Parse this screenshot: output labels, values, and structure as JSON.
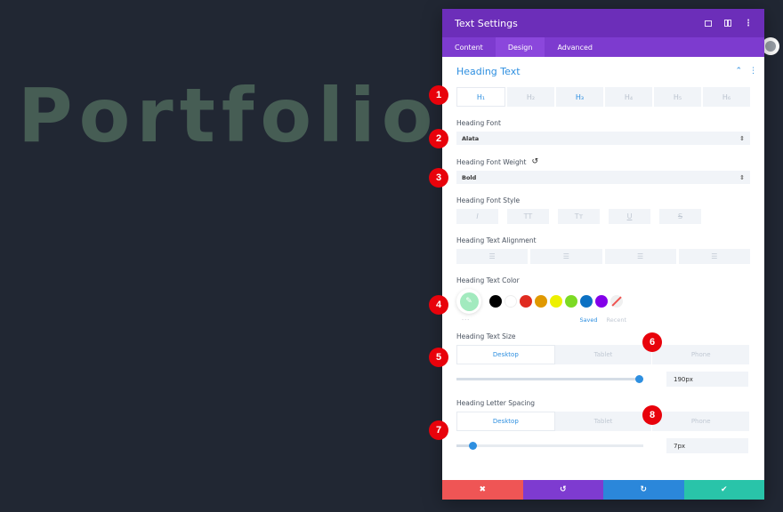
{
  "canvas": {
    "heading_text": "Portfolio"
  },
  "modal": {
    "title": "Text Settings",
    "header_icons": [
      "expand-icon",
      "split-view-icon",
      "more-options-icon"
    ],
    "tabs": [
      {
        "label": "Content",
        "active": false
      },
      {
        "label": "Design",
        "active": true
      },
      {
        "label": "Advanced",
        "active": false
      }
    ],
    "section": {
      "title": "Heading Text",
      "heading_levels": [
        {
          "label": "H₁",
          "state": "active"
        },
        {
          "label": "H₂",
          "state": "default"
        },
        {
          "label": "H₃",
          "state": "set"
        },
        {
          "label": "H₄",
          "state": "default"
        },
        {
          "label": "H₅",
          "state": "default"
        },
        {
          "label": "H₆",
          "state": "default"
        }
      ],
      "heading_font": {
        "label": "Heading Font",
        "value": "Alata"
      },
      "heading_font_weight": {
        "label": "Heading Font Weight",
        "value": "Bold"
      },
      "heading_font_style": {
        "label": "Heading Font Style",
        "buttons": [
          {
            "name": "italic",
            "glyph": "I"
          },
          {
            "name": "uppercase",
            "glyph": "TT"
          },
          {
            "name": "capitalize",
            "glyph": "Tт"
          },
          {
            "name": "underline",
            "glyph": "U"
          },
          {
            "name": "strikethrough",
            "glyph": "S"
          }
        ]
      },
      "heading_text_alignment": {
        "label": "Heading Text Alignment",
        "buttons": [
          "align-left",
          "align-center",
          "align-right",
          "justify"
        ]
      },
      "heading_text_color": {
        "label": "Heading Text Color",
        "selected": "#a2eabe",
        "swatches": [
          "#000000",
          "#ffffff",
          "#e02b20",
          "#e09900",
          "#edf000",
          "#7cda24",
          "#0c71c3",
          "#8300e9"
        ],
        "more_label": "···",
        "saved_label": "Saved",
        "recent_label": "Recent"
      },
      "heading_text_size": {
        "label": "Heading Text Size",
        "devices": [
          "Desktop",
          "Tablet",
          "Phone"
        ],
        "active_device": "Desktop",
        "value": "190px",
        "slider_fraction": 0.98
      },
      "heading_letter_spacing": {
        "label": "Heading Letter Spacing",
        "devices": [
          "Desktop",
          "Tablet",
          "Phone"
        ],
        "active_device": "Desktop",
        "value": "7px",
        "slider_fraction": 0.09
      }
    },
    "footer": {
      "buttons": [
        {
          "name": "cancel",
          "glyph": "✖",
          "color": "#ef5555"
        },
        {
          "name": "undo",
          "glyph": "↺",
          "color": "#7e3bd0"
        },
        {
          "name": "redo",
          "glyph": "↻",
          "color": "#2b87da"
        },
        {
          "name": "save",
          "glyph": "✔",
          "color": "#29c4a9"
        }
      ]
    }
  },
  "markers": [
    "1",
    "2",
    "3",
    "4",
    "5",
    "6",
    "7",
    "8"
  ],
  "colors": {
    "accent_blue": "#2e8fe0",
    "header_purple": "#6c2eb9",
    "tabs_purple": "#7d3bcf",
    "marker_red": "#e8020b",
    "background": "#212733",
    "hero_text": "#465d54"
  }
}
